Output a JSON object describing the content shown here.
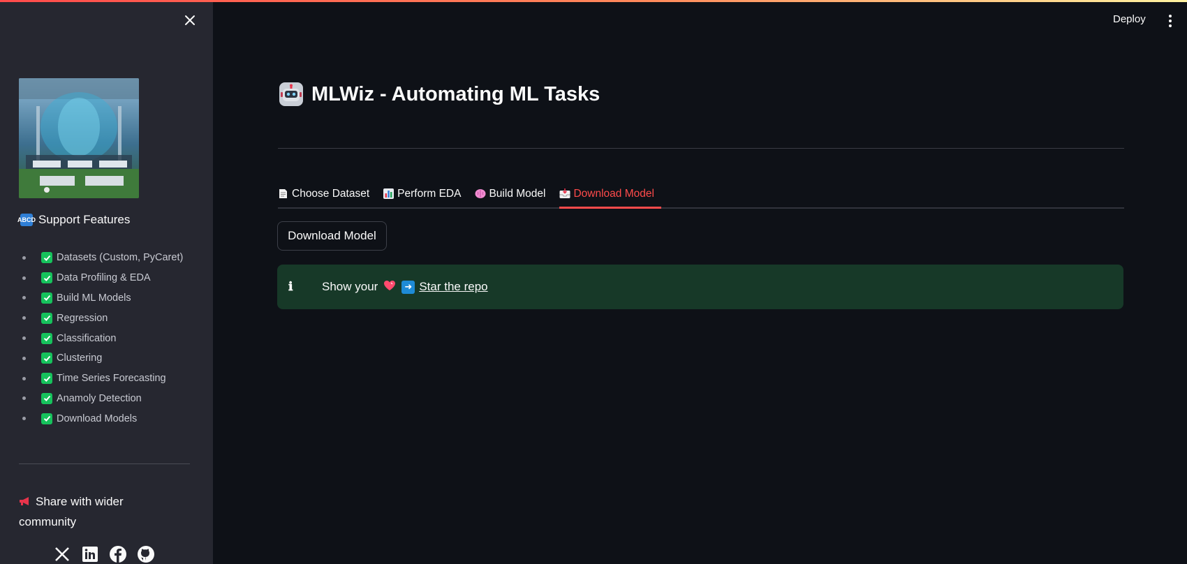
{
  "header": {
    "deploy_label": "Deploy"
  },
  "sidebar": {
    "support_title": "Support Features",
    "features": [
      "Datasets (Custom, PyCaret)",
      "Data Profiling & EDA",
      "Build ML Models",
      "Regression",
      "Classification",
      "Clustering",
      "Time Series Forecasting",
      "Anamoly Detection",
      "Download Models"
    ],
    "share_text": "Share with wider community",
    "social_icons": [
      "x-icon",
      "linkedin-icon",
      "facebook-icon",
      "github-icon"
    ]
  },
  "main": {
    "title": "MLWiz - Automating ML Tasks",
    "tabs": [
      {
        "label": "Choose Dataset",
        "icon": "page-icon"
      },
      {
        "label": "Perform EDA",
        "icon": "bar-chart-icon"
      },
      {
        "label": "Build Model",
        "icon": "brain-icon"
      },
      {
        "label": "Download Model",
        "icon": "inbox-icon",
        "active": true
      }
    ],
    "download_button": "Download Model",
    "alert": {
      "prefix": "Show your",
      "link_text": "Star the repo"
    }
  },
  "colors": {
    "accent": "#ff4b4b",
    "sidebar_bg": "#262730",
    "main_bg": "#0e1117",
    "success_bg": "#173928",
    "check_green": "#16c25c"
  }
}
